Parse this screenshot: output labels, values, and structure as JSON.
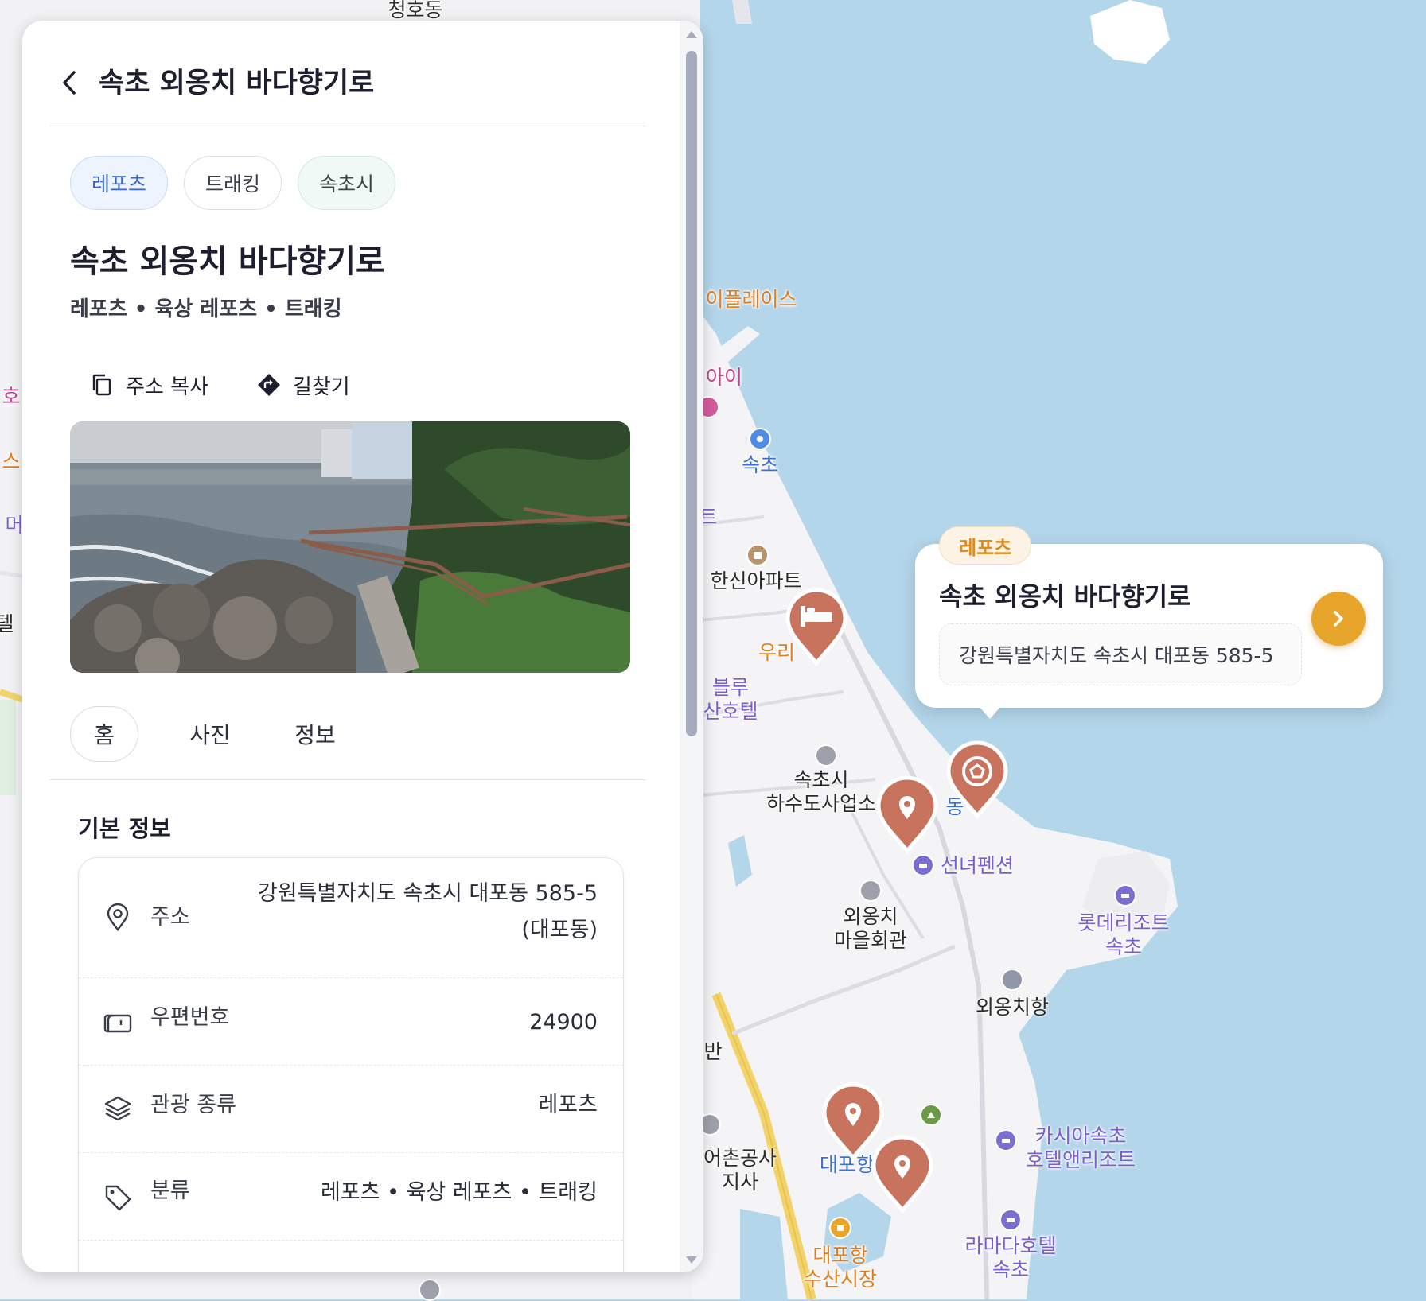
{
  "panel": {
    "header_title": "속초 외옹치 바다향기로",
    "chips": [
      "레포츠",
      "트래킹",
      "속초시"
    ],
    "title": "속초 외옹치 바다향기로",
    "subcategory": "레포츠 • 육상 레포츠 • 트래킹",
    "actions": {
      "copy_address": "주소 복사",
      "directions": "길찾기"
    },
    "tabs": [
      "홈",
      "사진",
      "정보"
    ],
    "section_title": "기본 정보",
    "info": {
      "address_label": "주소",
      "address_line1": "강원특별자치도 속초시 대포동 585-5",
      "address_line2": "(대포동)",
      "postal_label": "우편번호",
      "postal_value": "24900",
      "type_label": "관광 종류",
      "type_value": "레포츠",
      "category_label": "분류",
      "category_value": "레포츠 • 육상 레포츠 • 트래킹"
    }
  },
  "popup": {
    "badge": "레포츠",
    "title": "속초 외옹치 바다향기로",
    "address": "강원특별자치도 속초시 대포동 585-5"
  },
  "map": {
    "labels": [
      {
        "text": "청호동",
        "cls": "dark"
      },
      {
        "text": "이플레이스",
        "cls": "orange"
      },
      {
        "text": "아이",
        "cls": "pink"
      },
      {
        "text": "속초",
        "cls": "blue"
      },
      {
        "text": "트",
        "cls": "purple"
      },
      {
        "text": "한신아파트",
        "cls": "dark"
      },
      {
        "text": "우리",
        "cls": "orange"
      },
      {
        "text": "블루\n산호텔",
        "cls": "purple"
      },
      {
        "text": "속초시\n하수도사업소",
        "cls": "dark"
      },
      {
        "text": "동",
        "cls": "blue"
      },
      {
        "text": "선녀펜션",
        "cls": "purple"
      },
      {
        "text": "외옹치\n마을회관",
        "cls": "dark"
      },
      {
        "text": "롯데리조트\n속초",
        "cls": "purple"
      },
      {
        "text": "외옹치항",
        "cls": "dark"
      },
      {
        "text": "반",
        "cls": "dark"
      },
      {
        "text": "어촌공사\n지사",
        "cls": "dark"
      },
      {
        "text": "대포항선",
        "cls": "blue"
      },
      {
        "text": "카시아속초\n호텔앤리조트",
        "cls": "purple"
      },
      {
        "text": "라마다호텔\n속초",
        "cls": "purple"
      },
      {
        "text": "대포항\n수산시장",
        "cls": "orange"
      },
      {
        "text": "호",
        "cls": "pink"
      },
      {
        "text": "스",
        "cls": "orange"
      },
      {
        "text": "머",
        "cls": "purple"
      },
      {
        "text": "텔",
        "cls": "dark"
      }
    ]
  },
  "colors": {
    "marker": "#c8735e",
    "popup_go": "#e8a52c",
    "chip_selected": "#3865c8",
    "water": "#b4d6ea"
  }
}
